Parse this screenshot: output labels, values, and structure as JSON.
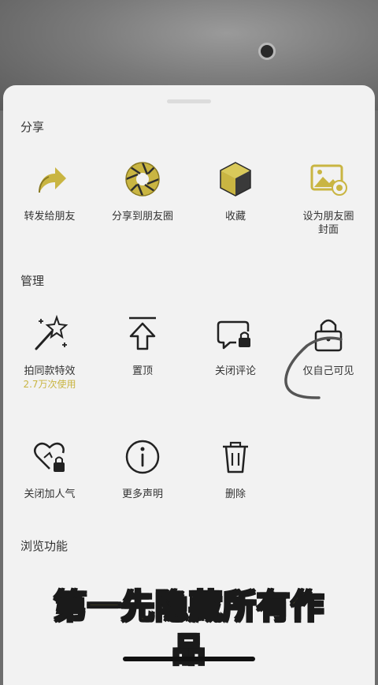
{
  "share": {
    "title": "分享",
    "items": [
      {
        "label": "转发给朋友",
        "icon": "forward-arrow-icon"
      },
      {
        "label": "分享到朋友圈",
        "icon": "moments-aperture-icon"
      },
      {
        "label": "收藏",
        "icon": "favorites-cube-icon"
      },
      {
        "label": "设为朋友圈\n封面",
        "icon": "cover-image-icon"
      }
    ]
  },
  "manage": {
    "title": "管理",
    "items": [
      {
        "label": "拍同款特效",
        "sub": "2.7万次使用",
        "icon": "magic-wand-icon"
      },
      {
        "label": "置顶",
        "icon": "pin-top-icon"
      },
      {
        "label": "关闭评论",
        "icon": "comment-lock-icon"
      },
      {
        "label": "仅自己可见",
        "icon": "lock-icon"
      },
      {
        "label": "关闭加人气",
        "icon": "heart-lock-icon"
      },
      {
        "label": "更多声明",
        "icon": "info-icon"
      },
      {
        "label": "删除",
        "icon": "trash-icon"
      }
    ]
  },
  "browse": {
    "title": "浏览功能"
  },
  "caption": {
    "line1": "第一先隐藏所有作",
    "line2": "品"
  },
  "colors": {
    "accent": "#c9b542",
    "sheet": "#f2f2f2",
    "caption_fill": "#e8d84a"
  }
}
